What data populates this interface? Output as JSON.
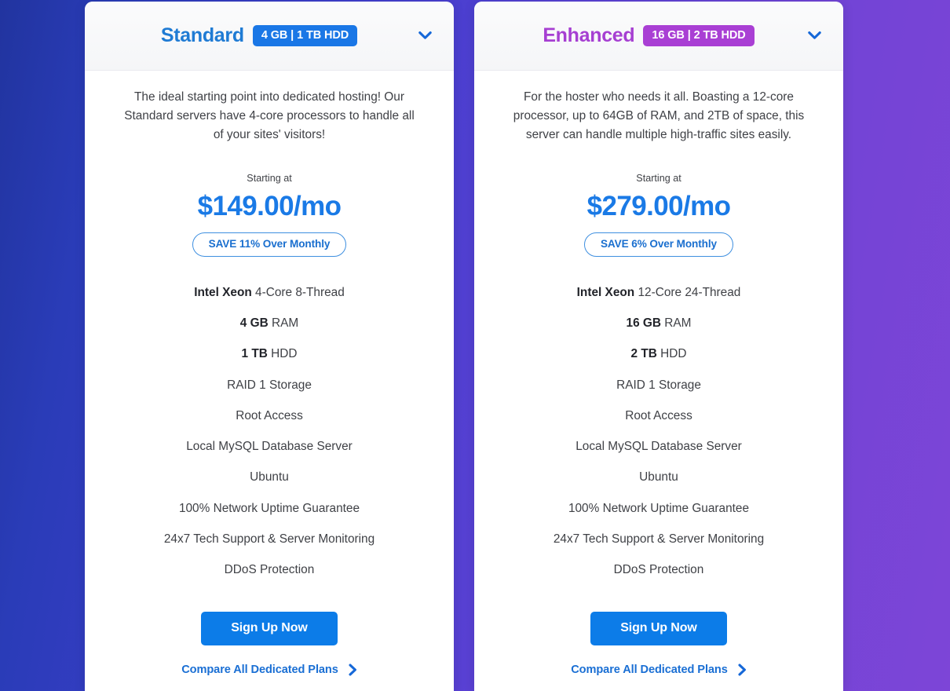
{
  "theme": {
    "bg_gradient_start": "#21349f",
    "bg_gradient_mid": "#4b3fd0",
    "bg_gradient_end": "#7d45d7",
    "accent_blue": "#1a7ae6",
    "accent_purple": "#a93fd4",
    "cta_blue": "#0c7ce8"
  },
  "plans": [
    {
      "id": "standard",
      "title": "Standard",
      "title_color": "#1f7bd4",
      "badge": "4 GB | 1 TB HDD",
      "badge_color": "#1a77e6",
      "description": "The ideal starting point into dedicated hosting! Our Standard servers have 4-core processors to handle all of your sites' visitors!",
      "starting_at": "Starting at",
      "price": "$149.00/mo",
      "save_label": "SAVE 11% Over Monthly",
      "features": [
        {
          "lead": "Intel Xeon",
          "rest": " 4-Core 8-Thread"
        },
        {
          "lead": "4 GB",
          "rest": " RAM"
        },
        {
          "lead": "1 TB",
          "rest": " HDD"
        },
        {
          "lead": "",
          "rest": "RAID 1 Storage"
        },
        {
          "lead": "",
          "rest": "Root Access"
        },
        {
          "lead": "",
          "rest": "Local MySQL Database Server"
        },
        {
          "lead": "",
          "rest": "Ubuntu"
        },
        {
          "lead": "",
          "rest": "100% Network Uptime Guarantee"
        },
        {
          "lead": "",
          "rest": "24x7 Tech Support & Server Monitoring"
        },
        {
          "lead": "",
          "rest": "DDoS Protection"
        }
      ],
      "signup_label": "Sign Up Now",
      "compare_label": "Compare All Dedicated Plans",
      "toggle_icon": "chevron-down-icon"
    },
    {
      "id": "enhanced",
      "title": "Enhanced",
      "title_color": "#a63fd2",
      "badge": "16 GB | 2 TB HDD",
      "badge_color": "#a93fd4",
      "description": "For the hoster who needs it all. Boasting a 12-core processor, up to 64GB of RAM, and 2TB of space, this server can handle multiple high-traffic sites easily.",
      "starting_at": "Starting at",
      "price": "$279.00/mo",
      "save_label": "SAVE 6% Over Monthly",
      "features": [
        {
          "lead": "Intel Xeon",
          "rest": " 12-Core 24-Thread"
        },
        {
          "lead": "16 GB",
          "rest": " RAM"
        },
        {
          "lead": "2 TB",
          "rest": " HDD"
        },
        {
          "lead": "",
          "rest": "RAID 1 Storage"
        },
        {
          "lead": "",
          "rest": "Root Access"
        },
        {
          "lead": "",
          "rest": "Local MySQL Database Server"
        },
        {
          "lead": "",
          "rest": "Ubuntu"
        },
        {
          "lead": "",
          "rest": "100% Network Uptime Guarantee"
        },
        {
          "lead": "",
          "rest": "24x7 Tech Support & Server Monitoring"
        },
        {
          "lead": "",
          "rest": "DDoS Protection"
        }
      ],
      "signup_label": "Sign Up Now",
      "compare_label": "Compare All Dedicated Plans",
      "toggle_icon": "chevron-down-icon"
    }
  ]
}
